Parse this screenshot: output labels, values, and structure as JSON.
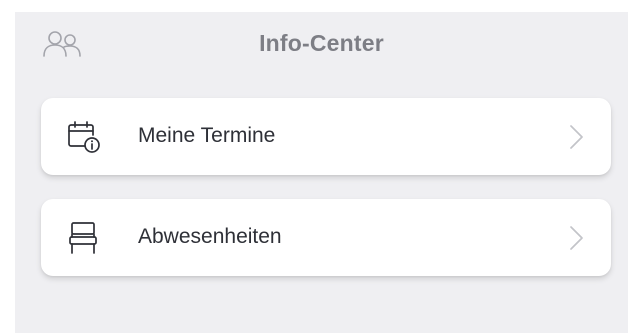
{
  "header": {
    "title": "Info-Center",
    "left_icon": "users-icon"
  },
  "menu": [
    {
      "label": "Meine Termine",
      "icon": "calendar-info-icon",
      "chevron": "chevron-right-icon"
    },
    {
      "label": "Abwesenheiten",
      "icon": "chair-icon",
      "chevron": "chevron-right-icon"
    }
  ],
  "colors": {
    "background": "#efeff2",
    "card": "#ffffff",
    "title": "#7d7e85",
    "label": "#2e3037",
    "icon_muted": "#9b9ca3",
    "chevron": "#c3c4c9"
  }
}
